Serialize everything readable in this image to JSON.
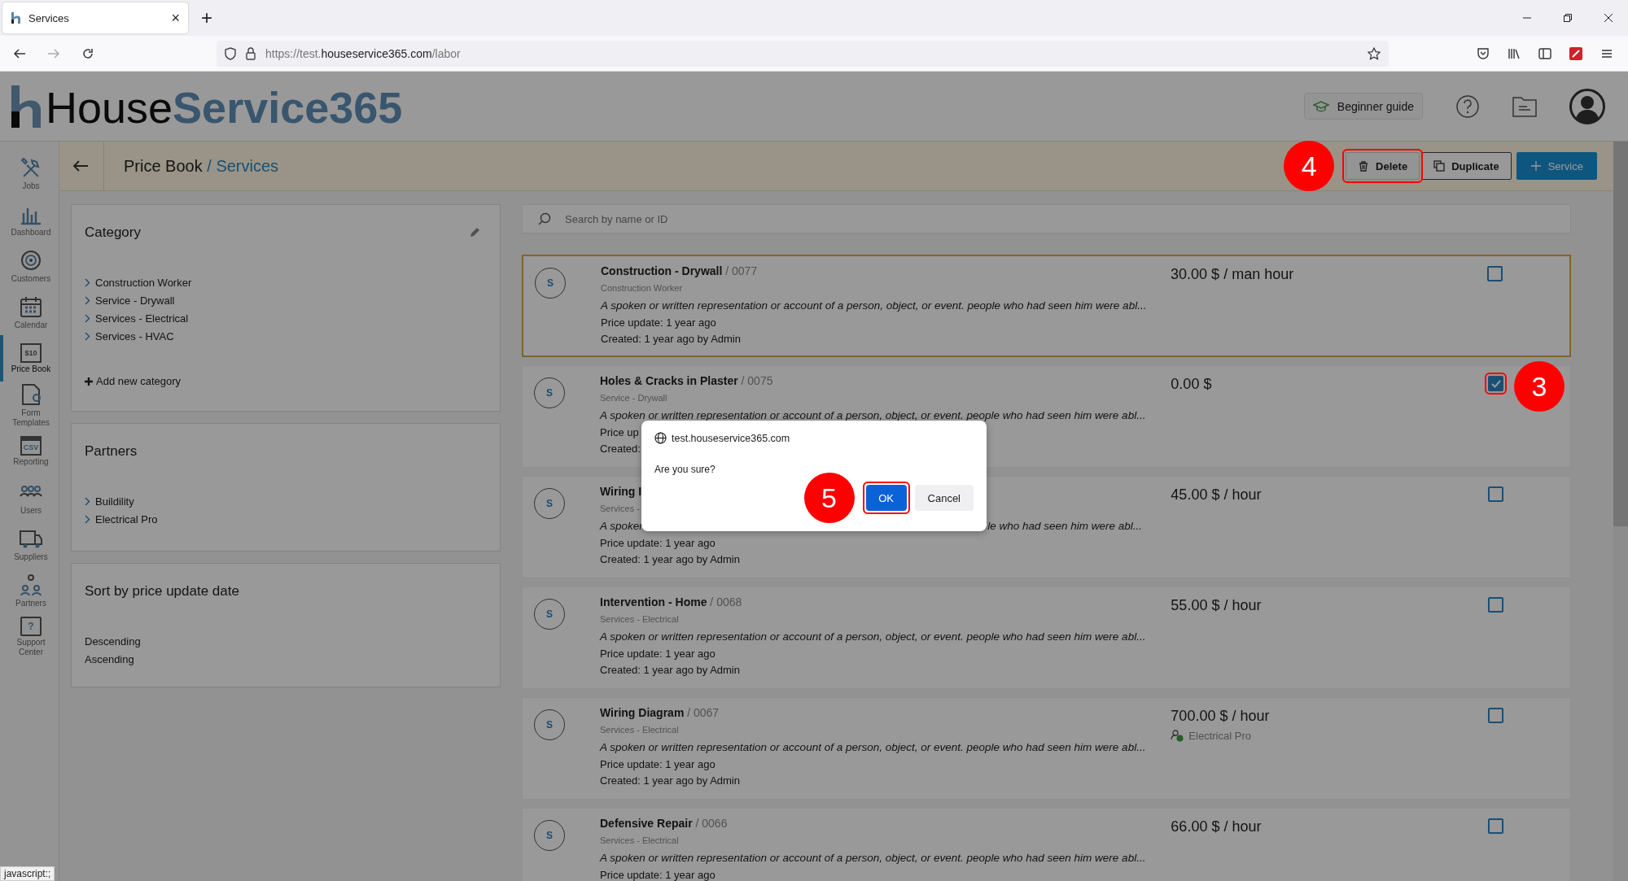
{
  "browser": {
    "tab": {
      "title": "Services",
      "close": "×"
    },
    "new_tab": "+",
    "url": {
      "prefix": "https://test.",
      "domain": "houseservice365.com",
      "path": "/labor"
    }
  },
  "app": {
    "logo": {
      "dark": "House",
      "light": "Service365"
    },
    "beginner_guide": "Beginner guide"
  },
  "sidebar": [
    {
      "label": "Jobs",
      "selected": false
    },
    {
      "label": "Dashboard",
      "selected": false
    },
    {
      "label": "Customers",
      "selected": false
    },
    {
      "label": "Calendar",
      "selected": false
    },
    {
      "label": "Price Book",
      "selected": true,
      "icon_text": "$10"
    },
    {
      "label": "Form Templates",
      "selected": false
    },
    {
      "label": "Reporting",
      "selected": false,
      "icon_text": "CSV"
    },
    {
      "label": "Users",
      "selected": false
    },
    {
      "label": "Suppliers",
      "selected": false
    },
    {
      "label": "Partners",
      "selected": false
    },
    {
      "label": "Support Center",
      "selected": false,
      "icon_text": "?"
    }
  ],
  "page_header": {
    "title": "Price Book",
    "current": "/ Services",
    "actions": [
      {
        "label": "Delete",
        "kind": "delete",
        "annotation": "4"
      },
      {
        "label": "Duplicate",
        "kind": "duplicate"
      },
      {
        "label": "Service",
        "kind": "add"
      }
    ]
  },
  "filters": [
    {
      "title": "Category",
      "editable": true,
      "items": [
        "Construction Worker",
        "Service - Drywall",
        "Services - Electrical",
        "Services - HVAC"
      ],
      "chevrons": true,
      "add": "Add new category"
    },
    {
      "title": "Partners",
      "editable": false,
      "items": [
        "Buildility",
        "Electrical Pro"
      ],
      "chevrons": true
    },
    {
      "title": "Sort by price update date",
      "editable": false,
      "items": [
        "Descending",
        "Ascending"
      ],
      "chevrons": false
    }
  ],
  "search": {
    "placeholder": "Search by name or ID"
  },
  "services": [
    {
      "avatar": "S",
      "title": "Construction - Drywall",
      "code": "/ 0077",
      "category": "Construction Worker",
      "description": [
        "A spoken or written representation or account of a person, object, or event. people who had seen him were abl..."
      ],
      "price_update": "Price update: 1 year ago",
      "created": "Created: 1 year ago by Admin",
      "price": "30.00 $ / man hour",
      "checked": false,
      "highlighted": true
    },
    {
      "avatar": "S",
      "title": "Holes & Cracks in Plaster",
      "code": "/ 0075",
      "category": "Service - Drywall",
      "description": [
        "A spoken or written representation or account of a person, object, or event. people who had seen him were abl..."
      ],
      "price_update": "Price up",
      "created": "Created:",
      "price": "0.00 $",
      "checked": true,
      "highlighted": false,
      "annotation": "3"
    },
    {
      "avatar": "S",
      "title": "Wiring I",
      "category": "Services -",
      "description": [
        "A spoken",
        "le who had seen him were abl..."
      ],
      "price_update": "Price update: 1 year ago",
      "created": "Created: 1 year ago by Admin",
      "price": "45.00 $ / hour",
      "checked": false,
      "highlighted": false
    },
    {
      "avatar": "S",
      "title": "Intervention - Home",
      "code": "/ 0068",
      "category": "Services - Electrical",
      "description": [
        "A spoken or written representation or account of a person, object, or event. people who had seen him were abl..."
      ],
      "price_update": "Price update: 1 year ago",
      "created": "Created: 1 year ago by Admin",
      "price": "55.00 $ / hour",
      "checked": false,
      "highlighted": false
    },
    {
      "avatar": "S",
      "title": "Wiring Diagram",
      "code": "/ 0067",
      "category": "Services - Electrical",
      "description": [
        "A spoken or written representation or account of a person, object, or event. people who had seen him were abl..."
      ],
      "price_update": "Price update: 1 year ago",
      "created": "Created: 1 year ago by Admin",
      "price": "700.00 $ / hour",
      "partner": "Electrical Pro",
      "checked": false,
      "highlighted": false
    },
    {
      "avatar": "S",
      "title": "Defensive Repair",
      "code": "/ 0066",
      "category": "Services - Electrical",
      "description": [
        "A spoken or written representation or account of a person, object, or event. people who had seen him were abl..."
      ],
      "price_update": "Price update: 1 year ago",
      "price": "66.00 $ / hour",
      "checked": false,
      "highlighted": false
    }
  ],
  "dialog": {
    "origin": "test.houseservice365.com",
    "message": "Are you sure?",
    "buttons": [
      {
        "label": "OK",
        "kind": "primary",
        "annotation": "5"
      },
      {
        "label": "Cancel",
        "kind": "secondary"
      }
    ]
  },
  "status_bar": "javascript:;"
}
